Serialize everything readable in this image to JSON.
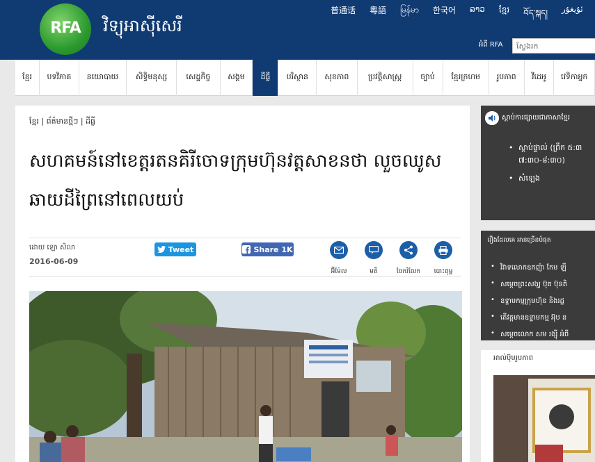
{
  "header": {
    "logo_text": "RFA",
    "site_name": "វិទ្យុអាស៊ីសេរី",
    "languages": [
      "普通话",
      "粵語",
      "မြန်မာ",
      "한국어",
      "ລາວ",
      "ខ្មែរ",
      "བོད་སྐད།",
      "ئۇيغۇر"
    ],
    "about_link": "អំពី RFA",
    "search_placeholder": "ស្វែងរក"
  },
  "nav": {
    "items": [
      {
        "label": "ខ្មែរ",
        "w": 36
      },
      {
        "label": "បទវិភាគ",
        "w": 58
      },
      {
        "label": "នយោបាយ",
        "w": 70
      },
      {
        "label": "សិទ្ធិមនុស្ស",
        "w": 74
      },
      {
        "label": "សេដ្ឋកិច្ច",
        "w": 64
      },
      {
        "label": "សង្គម",
        "w": 48
      },
      {
        "label": "ដីធ្លី",
        "w": 38,
        "active": true
      },
      {
        "label": "បរិស្ថាន",
        "w": 56
      },
      {
        "label": "សុខភាព",
        "w": 60
      },
      {
        "label": "ប្រវត្តិសាស្ត្រ",
        "w": 82
      },
      {
        "label": "ច្បាប់",
        "w": 44
      },
      {
        "label": "ខ្មែរក្រហម",
        "w": 68
      },
      {
        "label": "រូបភាព",
        "w": 52
      },
      {
        "label": "វីដេអូ",
        "w": 44
      },
      {
        "label": "វេទិកាអ្នក",
        "w": 60
      }
    ]
  },
  "article": {
    "breadcrumb": "ខ្មែរ | ព័ត៌មានថ្មីៗ | ដីធ្លី",
    "headline": "សហគមន៍នៅខេត្តរតនគិរីចោទក្រុមហ៊ុនវត្តសាខនថា លួចឈូសឆាយដីព្រៃនៅពេលយប់",
    "author": "ដោយ ឡោ សិលា",
    "date": "2016-06-09",
    "tweet_label": "Tweet",
    "share_label": "Share 1K",
    "tools": [
      "អ៊ីម៉ែល",
      "មតិ",
      "ចែករំលែក",
      "បោះពុម្ព"
    ]
  },
  "sidebar": {
    "listen_title": "ស្ដាប់ការផ្សាយជាភាសាខ្មែរ",
    "listen_items": [
      "ស្ដាប់ផ្ទាល់ (ព្រឹក ៥:៣",
      "៧:៣០-៨:៣០)",
      "សំឡេង"
    ],
    "popular_title": "រឿងដែលគេ អានច្រើនបំផុត",
    "popular_items": [
      "វិវាទលោកឧកញ៉ា កែម ឡី",
      "សម្ដេចព្រះសង្ឃ ប៊ុត ប៊ុនតិ",
      "ឧទ្ទាមកម្មក្រុមហ៊ុន និងរដ្ឋ",
      "តើវត្តមានឧទ្ទាមកម្ម អ៊ុប ន",
      "សម្ដេចលោក សម រង្ស៊ី អំពី"
    ],
    "album_label": "អាល់ប៊ុមរូបភាព"
  }
}
